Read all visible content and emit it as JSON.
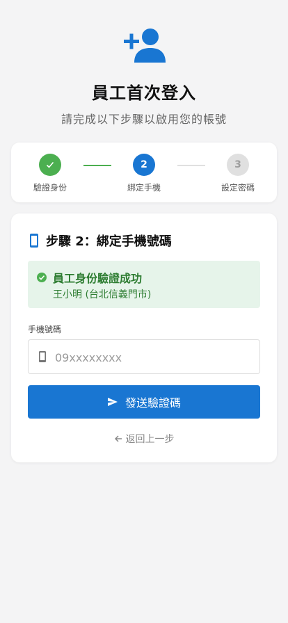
{
  "header": {
    "icon": "person-add-icon",
    "title": "員工首次登入",
    "subtitle": "請完成以下步驟以啟用您的帳號"
  },
  "stepper": {
    "steps": [
      {
        "number": "1",
        "label": "驗證身份",
        "status": "completed",
        "icon": "check-icon"
      },
      {
        "number": "2",
        "label": "綁定手機",
        "status": "active"
      },
      {
        "number": "3",
        "label": "設定密碼",
        "status": "pending"
      }
    ]
  },
  "form": {
    "title": "步驟 2：綁定手機號碼",
    "title_icon": "smartphone-icon",
    "success": {
      "icon": "check-circle-icon",
      "title": "員工身份驗證成功",
      "detail": "王小明 (台北信義門市)"
    },
    "phone_label": "手機號碼",
    "phone_placeholder": "09xxxxxxxx",
    "phone_value": "",
    "phone_icon": "smartphone-icon",
    "send_label": "發送驗證碼",
    "send_icon": "send-icon",
    "back_label": "返回上一步",
    "back_icon": "arrow-left-icon"
  },
  "colors": {
    "primary": "#1976d2",
    "success": "#4caf50",
    "success_text": "#2e7d32",
    "success_bg": "#e6f4ea",
    "pending": "#e0e0e0",
    "pending_text": "#9e9e9e"
  }
}
